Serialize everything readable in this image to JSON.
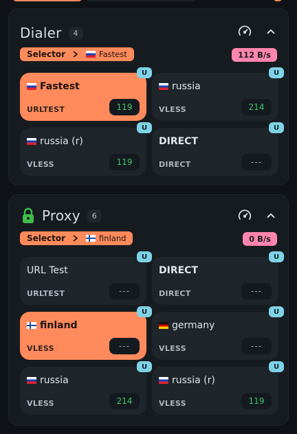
{
  "groups": [
    {
      "title": "Dialer",
      "count": "4",
      "selector": {
        "type": "Selector",
        "value": "Fastest",
        "flag": "russia-flag"
      },
      "rate": "112 B/s",
      "proxies": [
        {
          "name": "Fastest",
          "type": "URLTEST",
          "latency": "119",
          "badge": "U",
          "flag": "russia-flag",
          "active": true
        },
        {
          "name": "russia",
          "type": "VLESS",
          "latency": "214",
          "badge": "U",
          "flag": "russia-flag",
          "active": false
        },
        {
          "name": "russia (r)",
          "type": "VLESS",
          "latency": "119",
          "badge": "U",
          "flag": "russia-flag",
          "active": false
        },
        {
          "name": "DIRECT",
          "type": "DIRECT",
          "latency": "---",
          "badge": "U",
          "flag": "",
          "active": false
        }
      ]
    },
    {
      "title": "Proxy",
      "count": "6",
      "selector": {
        "type": "Selector",
        "value": "finland",
        "flag": "finland-flag"
      },
      "rate": "0 B/s",
      "proxies": [
        {
          "name": "URL Test",
          "type": "URLTEST",
          "latency": "---",
          "badge": "U",
          "flag": "",
          "active": false
        },
        {
          "name": "DIRECT",
          "type": "DIRECT",
          "latency": "---",
          "badge": "U",
          "flag": "",
          "active": false
        },
        {
          "name": "finland",
          "type": "VLESS",
          "latency": "---",
          "badge": "U",
          "flag": "finland-flag",
          "active": true
        },
        {
          "name": "germany",
          "type": "VLESS",
          "latency": "---",
          "badge": "U",
          "flag": "germany-flag",
          "active": false
        },
        {
          "name": "russia",
          "type": "VLESS",
          "latency": "214",
          "badge": "U",
          "flag": "russia-flag",
          "active": false
        },
        {
          "name": "russia (r)",
          "type": "VLESS",
          "latency": "119",
          "badge": "U",
          "flag": "russia-flag",
          "active": false
        }
      ]
    }
  ],
  "icons": {
    "lock": "lock-icon",
    "speed": "speedometer-icon",
    "collapse": "chevron-up-icon",
    "arrow": "chevron-right-icon"
  },
  "colors": {
    "accent": "#ff8a5c",
    "rate_badge": "#ff85ad",
    "latency_good": "#3fc66a",
    "badge_u": "#7fd3e6",
    "card": "#1e252b",
    "group": "#161b20"
  }
}
